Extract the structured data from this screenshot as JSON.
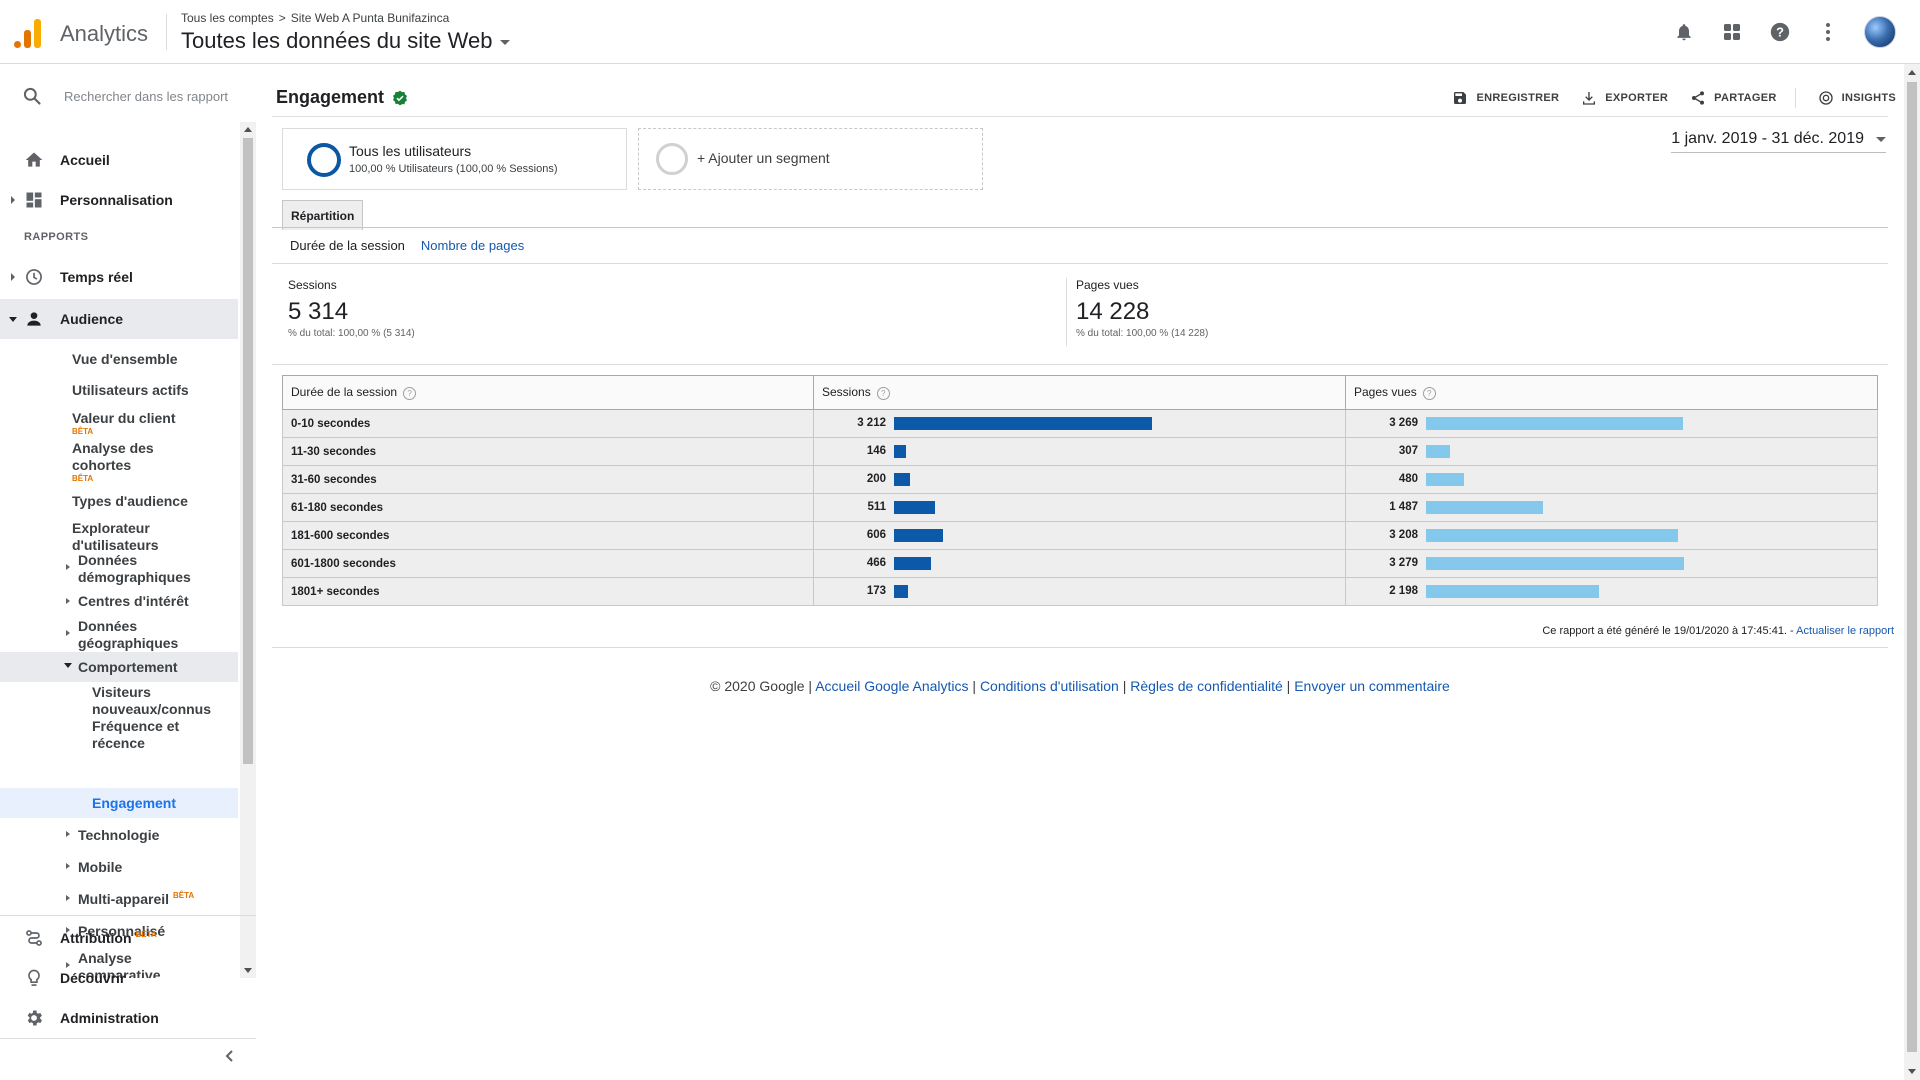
{
  "header": {
    "app_name": "Analytics",
    "breadcrumb_account": "Tous les comptes",
    "breadcrumb_property": "Site Web A Punta Bunifazinca",
    "view_name": "Toutes les données du site Web"
  },
  "sidebar": {
    "search_placeholder": "Rechercher dans les rapport",
    "home": "Accueil",
    "customization": "Personnalisation",
    "reports_section": "RAPPORTS",
    "realtime": "Temps réel",
    "audience": "Audience",
    "audience_items": {
      "overview": "Vue d'ensemble",
      "active_users": "Utilisateurs actifs",
      "ltv": "Valeur du client",
      "cohort": "Analyse des cohortes",
      "audiences": "Types d'audience",
      "user_explorer": "Explorateur d'utilisateurs",
      "demographics": "Données démographiques",
      "interests": "Centres d'intérêt",
      "geo": "Données géographiques",
      "behavior": "Comportement",
      "new_vs_returning": "Visiteurs nouveaux/connus",
      "frequency": "Fréquence et récence",
      "engagement": "Engagement",
      "technology": "Technologie",
      "mobile": "Mobile",
      "cross_device": "Multi-appareil",
      "custom": "Personnalisé",
      "benchmarking": "Analyse comparative"
    },
    "beta_label": "BÊTA",
    "attribution": "Attribution",
    "discover": "Découvrir",
    "admin": "Administration"
  },
  "report": {
    "title": "Engagement",
    "actions": {
      "save": "ENREGISTRER",
      "export": "EXPORTER",
      "share": "PARTAGER",
      "insights": "INSIGHTS"
    },
    "segment_name": "Tous les utilisateurs",
    "segment_detail": "100,00 % Utilisateurs (100,00 % Sessions)",
    "add_segment": "+ Ajouter un segment",
    "date_range": "1 janv. 2019 - 31 déc. 2019",
    "tab": "Répartition",
    "subtab_duration": "Durée de la session",
    "subtab_pages": "Nombre de pages",
    "metric_sessions_label": "Sessions",
    "metric_sessions_value": "5 314",
    "metric_sessions_sub": "% du total: 100,00 % (5 314)",
    "metric_pageviews_label": "Pages vues",
    "metric_pageviews_value": "14 228",
    "metric_pageviews_sub": "% du total: 100,00 % (14 228)",
    "col_duration": "Durée de la session",
    "col_sessions": "Sessions",
    "col_pageviews": "Pages vues",
    "help_icon": "?",
    "rows": [
      {
        "label": "0-10 secondes",
        "sessions": "3 212",
        "sessions_n": 3212,
        "pageviews": "3 269",
        "pageviews_n": 3269
      },
      {
        "label": "11-30 secondes",
        "sessions": "146",
        "sessions_n": 146,
        "pageviews": "307",
        "pageviews_n": 307
      },
      {
        "label": "31-60 secondes",
        "sessions": "200",
        "sessions_n": 200,
        "pageviews": "480",
        "pageviews_n": 480
      },
      {
        "label": "61-180 secondes",
        "sessions": "511",
        "sessions_n": 511,
        "pageviews": "1 487",
        "pageviews_n": 1487
      },
      {
        "label": "181-600 secondes",
        "sessions": "606",
        "sessions_n": 606,
        "pageviews": "3 208",
        "pageviews_n": 3208
      },
      {
        "label": "601-1800 secondes",
        "sessions": "466",
        "sessions_n": 466,
        "pageviews": "3 279",
        "pageviews_n": 3279
      },
      {
        "label": "1801+ secondes",
        "sessions": "173",
        "sessions_n": 173,
        "pageviews": "2 198",
        "pageviews_n": 2198
      }
    ],
    "generated_note": "Ce rapport a été généré le 19/01/2020 à 17:45:41. -",
    "refresh_link": "Actualiser le rapport"
  },
  "footer": {
    "copyright": "© 2020 Google |",
    "link_home": "Accueil Google Analytics",
    "link_terms": "Conditions d'utilisation",
    "link_privacy": "Règles de confidentialité",
    "link_feedback": "Envoyer un commentaire",
    "sep": "|"
  },
  "colors": {
    "sessions_bar": "#0b59a8",
    "pageviews_bar": "#84c9ec",
    "link": "#1558b0",
    "beta": "#e37400"
  }
}
